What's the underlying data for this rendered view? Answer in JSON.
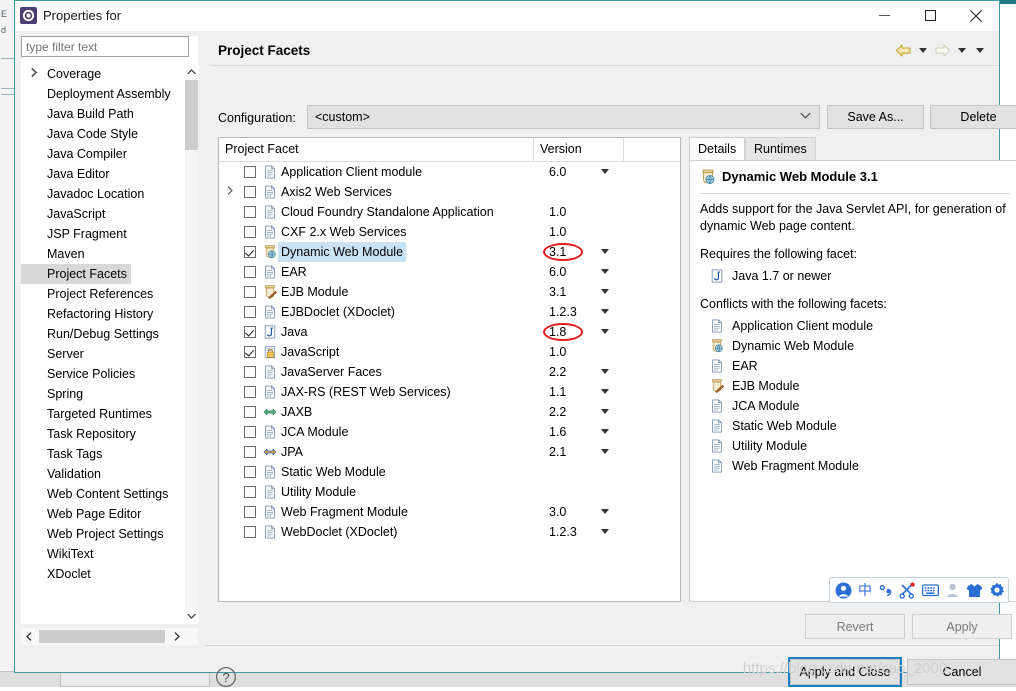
{
  "window": {
    "title": "Properties for",
    "icon": "eclipse-properties-icon",
    "controls": {
      "minimize": "—",
      "maximize": "☐",
      "close": "✕"
    }
  },
  "filter": {
    "placeholder": "type filter text",
    "value": ""
  },
  "sidebar": {
    "items": [
      {
        "label": "Coverage",
        "expandable": false,
        "selected": false
      },
      {
        "label": "Deployment Assembly",
        "expandable": false,
        "selected": false
      },
      {
        "label": "Java Build Path",
        "expandable": false,
        "selected": false
      },
      {
        "label": "Java Code Style",
        "expandable": true,
        "selected": false
      },
      {
        "label": "Java Compiler",
        "expandable": true,
        "selected": false
      },
      {
        "label": "Java Editor",
        "expandable": true,
        "selected": false
      },
      {
        "label": "Javadoc Location",
        "expandable": false,
        "selected": false
      },
      {
        "label": "JavaScript",
        "expandable": true,
        "selected": false
      },
      {
        "label": "JSP Fragment",
        "expandable": false,
        "selected": false
      },
      {
        "label": "Maven",
        "expandable": true,
        "selected": false
      },
      {
        "label": "Project Facets",
        "expandable": false,
        "selected": true
      },
      {
        "label": "Project References",
        "expandable": false,
        "selected": false
      },
      {
        "label": "Refactoring History",
        "expandable": false,
        "selected": false
      },
      {
        "label": "Run/Debug Settings",
        "expandable": false,
        "selected": false
      },
      {
        "label": "Server",
        "expandable": false,
        "selected": false
      },
      {
        "label": "Service Policies",
        "expandable": false,
        "selected": false
      },
      {
        "label": "Spring",
        "expandable": true,
        "selected": false
      },
      {
        "label": "Targeted Runtimes",
        "expandable": false,
        "selected": false
      },
      {
        "label": "Task Repository",
        "expandable": true,
        "selected": false
      },
      {
        "label": "Task Tags",
        "expandable": false,
        "selected": false
      },
      {
        "label": "Validation",
        "expandable": true,
        "selected": false
      },
      {
        "label": "Web Content Settings",
        "expandable": false,
        "selected": false
      },
      {
        "label": "Web Page Editor",
        "expandable": false,
        "selected": false
      },
      {
        "label": "Web Project Settings",
        "expandable": false,
        "selected": false
      },
      {
        "label": "WikiText",
        "expandable": false,
        "selected": false
      },
      {
        "label": "XDoclet",
        "expandable": true,
        "selected": false
      }
    ]
  },
  "page": {
    "title": "Project Facets",
    "nav": {
      "back_icon": "arrow-left-icon",
      "back_dropdown_icon": "chevron-down-icon",
      "forward_icon": "arrow-right-icon",
      "forward_dropdown_icon": "chevron-down-icon",
      "menu_icon": "chevron-down-icon"
    }
  },
  "configuration": {
    "label": "Configuration:",
    "value": "<custom>",
    "dropdown_icon": "chevron-down-icon",
    "save_as_label": "Save As...",
    "delete_label": "Delete"
  },
  "facet_table": {
    "headers": {
      "name": "Project Facet",
      "version": "Version",
      "spacer": ""
    },
    "rows": [
      {
        "label": "Application Client module",
        "version": "6.0",
        "checked": false,
        "expandable": false,
        "icon": "document-icon",
        "has_dropdown": true,
        "highlighted": false,
        "annotated": false
      },
      {
        "label": "Axis2 Web Services",
        "version": "",
        "checked": false,
        "expandable": true,
        "icon": "document-icon",
        "has_dropdown": false,
        "highlighted": false,
        "annotated": false
      },
      {
        "label": "Cloud Foundry Standalone Application",
        "version": "1.0",
        "checked": false,
        "expandable": false,
        "icon": "document-icon",
        "has_dropdown": false,
        "highlighted": false,
        "annotated": false
      },
      {
        "label": "CXF 2.x Web Services",
        "version": "1.0",
        "checked": false,
        "expandable": false,
        "icon": "document-icon",
        "has_dropdown": false,
        "highlighted": false,
        "annotated": false
      },
      {
        "label": "Dynamic Web Module",
        "version": "3.1",
        "checked": true,
        "expandable": false,
        "icon": "web-module-icon",
        "has_dropdown": true,
        "highlighted": true,
        "annotated": true
      },
      {
        "label": "EAR",
        "version": "6.0",
        "checked": false,
        "expandable": false,
        "icon": "document-icon",
        "has_dropdown": true,
        "highlighted": false,
        "annotated": false
      },
      {
        "label": "EJB Module",
        "version": "3.1",
        "checked": false,
        "expandable": false,
        "icon": "ejb-module-icon",
        "has_dropdown": true,
        "highlighted": false,
        "annotated": false
      },
      {
        "label": "EJBDoclet (XDoclet)",
        "version": "1.2.3",
        "checked": false,
        "expandable": false,
        "icon": "document-icon",
        "has_dropdown": true,
        "highlighted": false,
        "annotated": false
      },
      {
        "label": "Java",
        "version": "1.8",
        "checked": true,
        "expandable": false,
        "icon": "java-icon",
        "has_dropdown": true,
        "highlighted": false,
        "annotated": true
      },
      {
        "label": "JavaScript",
        "version": "1.0",
        "checked": true,
        "expandable": false,
        "icon": "javascript-icon",
        "has_dropdown": false,
        "highlighted": false,
        "annotated": false
      },
      {
        "label": "JavaServer Faces",
        "version": "2.2",
        "checked": false,
        "expandable": false,
        "icon": "document-icon",
        "has_dropdown": true,
        "highlighted": false,
        "annotated": false
      },
      {
        "label": "JAX-RS (REST Web Services)",
        "version": "1.1",
        "checked": false,
        "expandable": false,
        "icon": "document-icon",
        "has_dropdown": true,
        "highlighted": false,
        "annotated": false
      },
      {
        "label": "JAXB",
        "version": "2.2",
        "checked": false,
        "expandable": false,
        "icon": "jaxb-icon",
        "has_dropdown": true,
        "highlighted": false,
        "annotated": false
      },
      {
        "label": "JCA Module",
        "version": "1.6",
        "checked": false,
        "expandable": false,
        "icon": "document-icon",
        "has_dropdown": true,
        "highlighted": false,
        "annotated": false
      },
      {
        "label": "JPA",
        "version": "2.1",
        "checked": false,
        "expandable": false,
        "icon": "jpa-icon",
        "has_dropdown": true,
        "highlighted": false,
        "annotated": false
      },
      {
        "label": "Static Web Module",
        "version": "",
        "checked": false,
        "expandable": false,
        "icon": "document-icon",
        "has_dropdown": false,
        "highlighted": false,
        "annotated": false
      },
      {
        "label": "Utility Module",
        "version": "",
        "checked": false,
        "expandable": false,
        "icon": "document-icon",
        "has_dropdown": false,
        "highlighted": false,
        "annotated": false
      },
      {
        "label": "Web Fragment Module",
        "version": "3.0",
        "checked": false,
        "expandable": false,
        "icon": "document-icon",
        "has_dropdown": true,
        "highlighted": false,
        "annotated": false
      },
      {
        "label": "WebDoclet (XDoclet)",
        "version": "1.2.3",
        "checked": false,
        "expandable": false,
        "icon": "document-icon",
        "has_dropdown": true,
        "highlighted": false,
        "annotated": false
      }
    ]
  },
  "details": {
    "tabs": [
      {
        "label": "Details",
        "active": true
      },
      {
        "label": "Runtimes",
        "active": false
      }
    ],
    "title": "Dynamic Web Module 3.1",
    "title_icon": "web-module-icon",
    "description": "Adds support for the Java Servlet API, for generation of dynamic Web page content.",
    "requires_label": "Requires the following facet:",
    "requires": [
      {
        "label": "Java 1.7 or newer",
        "icon": "java-icon"
      }
    ],
    "conflicts_label": "Conflicts with the following facets:",
    "conflicts": [
      {
        "label": "Application Client module",
        "icon": "document-icon"
      },
      {
        "label": "Dynamic Web Module",
        "icon": "web-module-icon"
      },
      {
        "label": "EAR",
        "icon": "document-icon"
      },
      {
        "label": "EJB Module",
        "icon": "ejb-module-icon"
      },
      {
        "label": "JCA Module",
        "icon": "document-icon"
      },
      {
        "label": "Static Web Module",
        "icon": "document-icon"
      },
      {
        "label": "Utility Module",
        "icon": "document-icon"
      },
      {
        "label": "Web Fragment Module",
        "icon": "document-icon"
      }
    ]
  },
  "buttons": {
    "revert": "Revert",
    "apply": "Apply",
    "apply_and_close": "Apply and Close",
    "cancel": "Cancel",
    "help_icon": "help-question-icon"
  },
  "ime_toolbar": {
    "items": [
      {
        "name": "ime-logo-icon",
        "glyph": ""
      },
      {
        "name": "chinese-mode-icon",
        "glyph": "中"
      },
      {
        "name": "punctuation-icon",
        "glyph": "，"
      },
      {
        "name": "scissors-icon",
        "glyph": ""
      },
      {
        "name": "keyboard-icon",
        "glyph": ""
      },
      {
        "name": "user-icon",
        "glyph": ""
      },
      {
        "name": "skin-shirt-icon",
        "glyph": ""
      },
      {
        "name": "gear-icon",
        "glyph": ""
      }
    ]
  },
  "scrollbars": {
    "sidebar_vertical_up_icon": "chevron-up-icon",
    "sidebar_vertical_down_icon": "chevron-down-icon",
    "sidebar_horizontal_left_icon": "chevron-left-icon",
    "sidebar_horizontal_right_icon": "chevron-right-icon"
  },
  "watermark": "https://blog.csdn.net/cao_2000",
  "background": {
    "left_letters": [
      "E",
      "d"
    ]
  },
  "colors": {
    "accent_teal": "#3c9aa8",
    "selection_blue": "#c9e3f5",
    "annotation_red": "#e11d1d",
    "focus_blue": "#1a7fc1",
    "ime_blue": "#2a6fd6"
  }
}
